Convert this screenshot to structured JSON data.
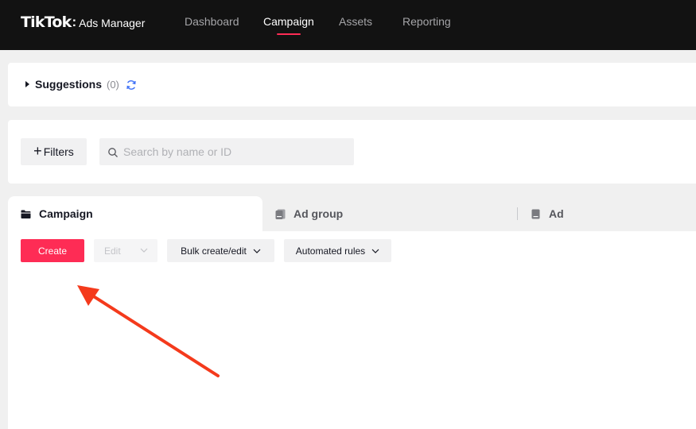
{
  "header": {
    "logo_main": "TikTok",
    "logo_colon": ":",
    "logo_sub": "Ads Manager",
    "nav": [
      {
        "label": "Dashboard",
        "active": false
      },
      {
        "label": "Campaign",
        "active": true
      },
      {
        "label": "Assets",
        "active": false
      },
      {
        "label": "Reporting",
        "active": false
      }
    ]
  },
  "suggestions": {
    "label": "Suggestions",
    "count": "(0)"
  },
  "filter_bar": {
    "filters_label": "Filters",
    "search_placeholder": "Search by name or ID",
    "search_value": ""
  },
  "tabs": [
    {
      "label": "Campaign",
      "active": true,
      "icon": "folder-icon"
    },
    {
      "label": "Ad group",
      "active": false,
      "icon": "ad-group-icon"
    },
    {
      "label": "Ad",
      "active": false,
      "icon": "ad-icon"
    }
  ],
  "toolbar": {
    "create_label": "Create",
    "edit_label": "Edit",
    "bulk_label": "Bulk create/edit",
    "automated_label": "Automated rules"
  },
  "colors": {
    "accent": "#fe2c55",
    "topbar": "#121212",
    "annotation_arrow": "#f43a1c"
  }
}
